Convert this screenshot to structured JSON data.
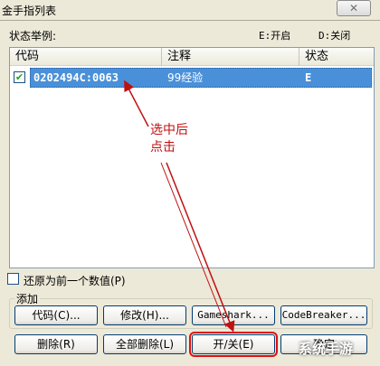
{
  "window": {
    "title": "金手指列表",
    "close_label": "✕"
  },
  "hints": {
    "state_example": "状态举例:",
    "on": "E:开启",
    "off": "D:关闭"
  },
  "list": {
    "columns": [
      "代码",
      "注释",
      "状态"
    ],
    "rows": [
      {
        "checked": true,
        "code": "0202494C:0063",
        "note": "99经验",
        "status": "E"
      }
    ]
  },
  "annotation": {
    "line1": "选中后",
    "line2": "点击",
    "color": "#c01010"
  },
  "restore": {
    "checked": false,
    "label": "还原为前一个数值(P)"
  },
  "add_group": {
    "label": "添加",
    "buttons": [
      "代码(C)...",
      "修改(H)...",
      "Gameshark...",
      "CodeBreaker..."
    ]
  },
  "bottom_buttons": {
    "delete": "删除(R)",
    "delete_all": "全部删除(L)",
    "toggle": "开/关(E)",
    "ok_partial": "确定"
  },
  "watermark": "系统手游"
}
